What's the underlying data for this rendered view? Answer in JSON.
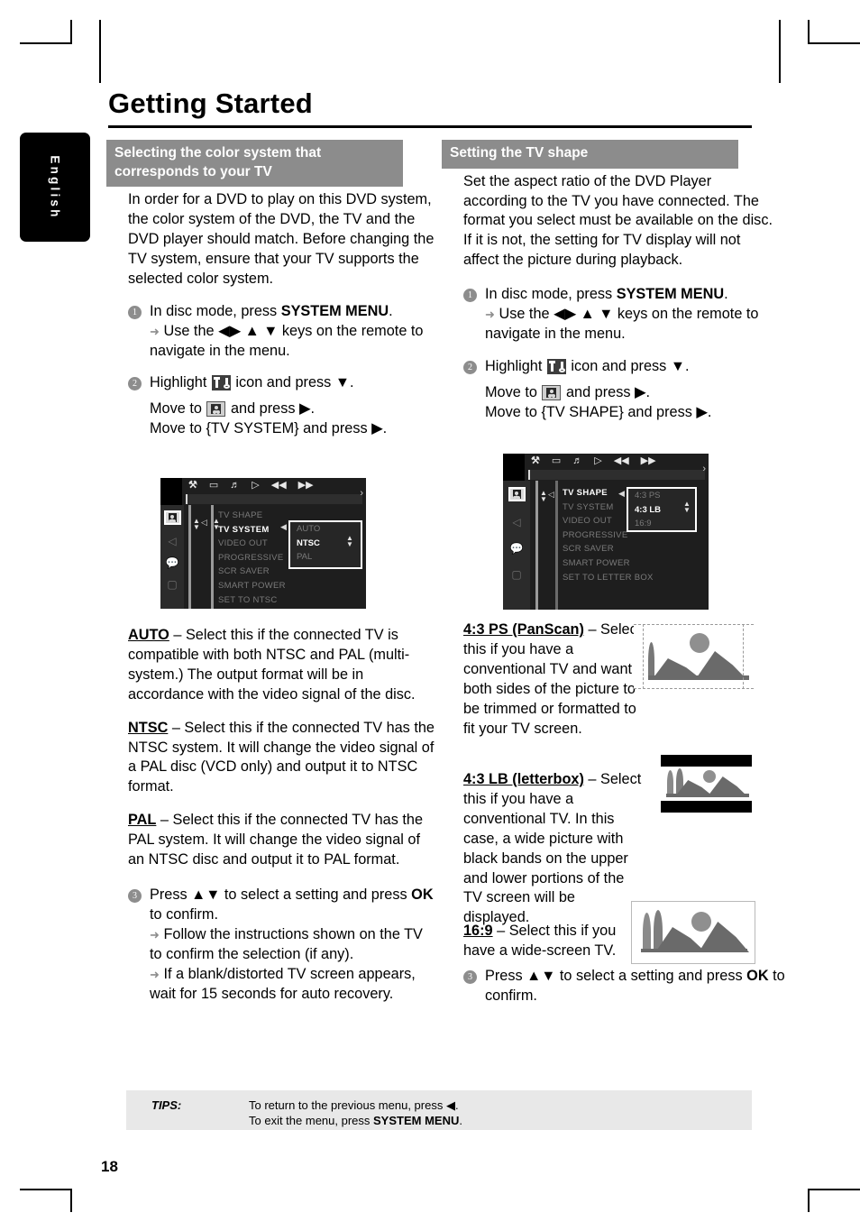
{
  "page": {
    "title": "Getting Started",
    "language_tab": "English",
    "page_number": "18"
  },
  "left_column": {
    "section_title": "Selecting the color system that corresponds to your TV",
    "intro": "In order for a DVD to play on this DVD system, the color system of the DVD, the TV and the DVD player should match. Before changing the TV system, ensure that your TV supports the selected color system.",
    "steps": [
      {
        "num": "1",
        "line1_pre": "In disc mode, press ",
        "line1_bold": "SYSTEM MENU",
        "line1_post": ".",
        "line2": "Use the ◀▶ ▲ ▼ keys on the remote to navigate in the menu."
      },
      {
        "num": "2",
        "highlight_pre": "Highlight ",
        "highlight_post": " icon and press ▼.",
        "move1_pre": "Move to ",
        "move1_post": " and press ▶.",
        "move2": "Move to {TV SYSTEM} and press ▶."
      },
      {
        "num": "3",
        "line1_pre": "Press ▲▼ to select a setting and press ",
        "line1_bold": "OK",
        "line1_post": " to confirm.",
        "line2": "Follow the instructions shown on the TV to confirm the selection (if any).",
        "line3": "If a blank/distorted TV screen appears, wait for 15 seconds for auto recovery."
      }
    ],
    "options": [
      {
        "term": "AUTO",
        "text": " – Select this if the connected TV is compatible with both NTSC and PAL (multi-system.)  The output format will be in accordance with the video signal of the disc."
      },
      {
        "term": "NTSC",
        "text": " – Select this if the connected TV has the NTSC system. It will change the video signal of a PAL disc (VCD only) and output it to NTSC format."
      },
      {
        "term": "PAL",
        "text": " – Select this if the connected TV has the PAL system. It will change the video signal of an NTSC disc and output it to PAL format."
      }
    ],
    "osd": {
      "toolbar_icons": [
        "tools-icon",
        "display-icon",
        "audio-icon",
        "play-icon",
        "rewind-icon",
        "forward-icon"
      ],
      "menu_items": [
        "TV SHAPE",
        "TV SYSTEM",
        "VIDEO OUT",
        "PROGRESSIVE",
        "SCR SAVER",
        "SMART POWER",
        "SET TO NTSC"
      ],
      "selected_menu_item": "TV SYSTEM",
      "popup_items": [
        "AUTO",
        "NTSC",
        "PAL"
      ],
      "selected_popup_item": "NTSC"
    }
  },
  "right_column": {
    "section_title": "Setting the TV shape",
    "intro": "Set the aspect ratio of the DVD Player according to the TV you have connected. The format you select must be available on the disc.  If it is not, the setting for TV display will not affect the picture during playback.",
    "steps": [
      {
        "num": "1",
        "line1_pre": "In disc mode, press ",
        "line1_bold": "SYSTEM MENU",
        "line1_post": ".",
        "line2": "Use the ◀▶ ▲ ▼ keys on the remote to navigate in the menu."
      },
      {
        "num": "2",
        "highlight_pre": "Highlight ",
        "highlight_post": " icon and press ▼.",
        "move1_pre": "Move to ",
        "move1_post": " and press ▶.",
        "move2": "Move to {TV SHAPE} and press ▶."
      },
      {
        "num": "3",
        "line1_pre": "Press ▲▼ to select a setting and press ",
        "line1_bold": "OK",
        "line1_post": " to confirm."
      }
    ],
    "options": [
      {
        "term": "4:3 PS (PanScan)",
        "text": " – Select this if you have a conventional TV and want both sides of the picture to be trimmed or formatted to fit your TV screen.",
        "image_name": "panscan-preview"
      },
      {
        "term": "4:3 LB (letterbox)",
        "text": " – Select this if you have a conventional TV. In this case, a wide picture with black bands on the upper and lower portions of the TV screen will be displayed.",
        "image_name": "letterbox-preview"
      },
      {
        "term": "16:9",
        "text": "  – Select this if you have a wide-screen TV.",
        "image_name": "widescreen-preview"
      }
    ],
    "osd": {
      "toolbar_icons": [
        "tools-icon",
        "display-icon",
        "audio-icon",
        "play-icon",
        "rewind-icon",
        "forward-icon"
      ],
      "menu_items": [
        "TV SHAPE",
        "TV SYSTEM",
        "VIDEO OUT",
        "PROGRESSIVE",
        "SCR  SAVER",
        "SMART POWER",
        "SET TO LETTER BOX"
      ],
      "selected_menu_item": "TV SHAPE",
      "popup_items": [
        "4:3 PS",
        "4:3 LB",
        "16:9"
      ],
      "selected_popup_item": "4:3 LB"
    }
  },
  "tips": {
    "label": "TIPS:",
    "line1": "To return to the previous menu, press ◀.",
    "line2_pre": "To exit the menu, press ",
    "line2_bold": "SYSTEM MENU",
    "line2_post": "."
  },
  "colors": {
    "section_header_bg": "#8c8c8c",
    "tips_bg": "#e8e8e8",
    "step_bullet": "#8d8d8d",
    "osd_bg": "#1e1e1e"
  }
}
